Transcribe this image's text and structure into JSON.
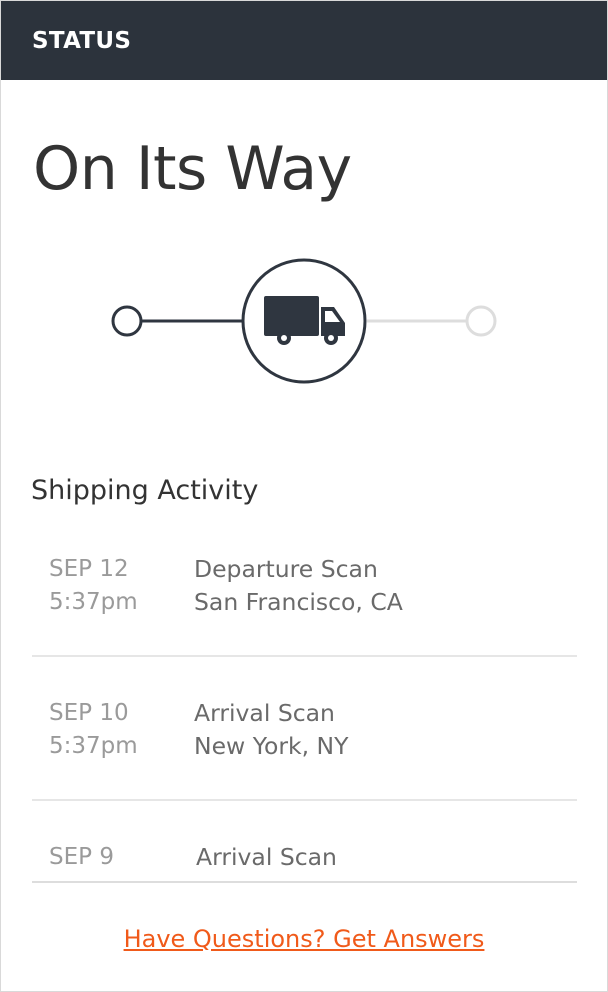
{
  "header": {
    "title": "STATUS"
  },
  "status": {
    "title": "On Its Way",
    "current_step_icon": "truck-icon",
    "steps_total": 3,
    "current_step": 2
  },
  "activity": {
    "title": "Shipping Activity",
    "items": [
      {
        "date": "SEP 12",
        "time": "5:37pm",
        "event": "Departure Scan",
        "location": "San Francisco, CA"
      },
      {
        "date": "SEP 10",
        "time": "5:37pm",
        "event": "Arrival Scan",
        "location": "New York, NY"
      },
      {
        "date": "SEP 9",
        "time": "",
        "event": "Arrival Scan",
        "location": ""
      }
    ]
  },
  "footer": {
    "help_link": "Have Questions? Get Answers"
  },
  "colors": {
    "header_bg": "#2c333c",
    "accent_link": "#f05a1a",
    "active_line": "#2f3640",
    "inactive_line": "#dddddd"
  }
}
